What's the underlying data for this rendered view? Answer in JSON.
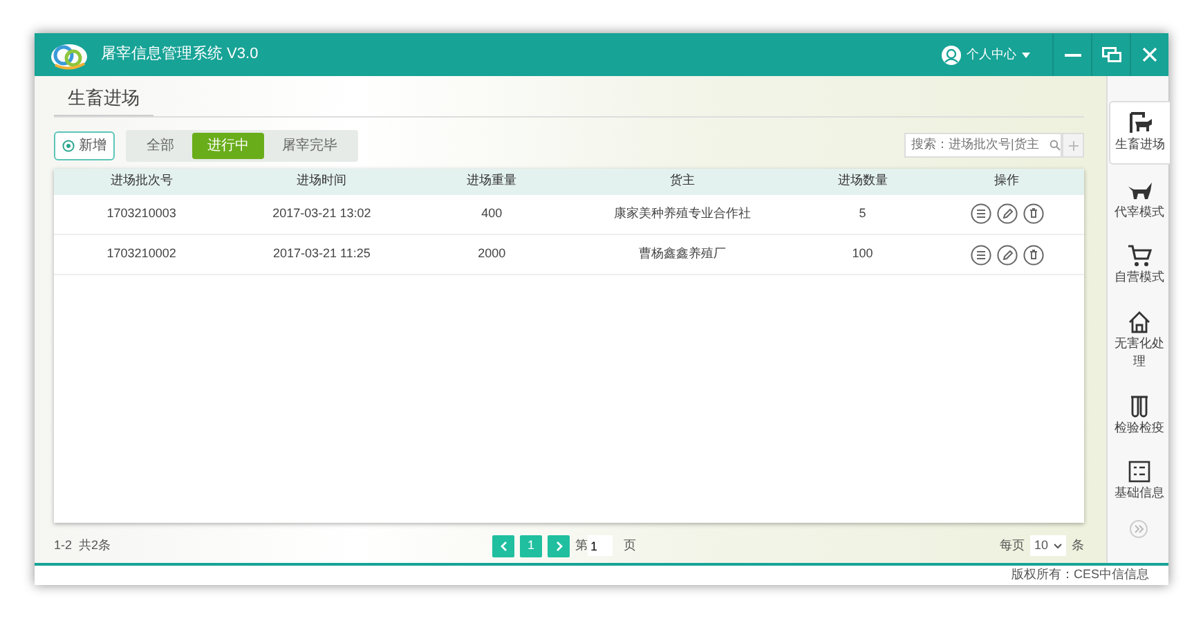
{
  "window": {
    "title": "屠宰信息管理系统 V3.0",
    "user_menu": "个人中心"
  },
  "page": {
    "title": "生畜进场"
  },
  "toolbar": {
    "add_button": "新增",
    "filters": [
      {
        "label": "全部",
        "selected": false
      },
      {
        "label": "进行中",
        "selected": true
      },
      {
        "label": "屠宰完毕",
        "selected": false
      }
    ],
    "search": {
      "placeholder": "搜索：进场批次号|货主"
    }
  },
  "table": {
    "columns": [
      "进场批次号",
      "进场时间",
      "进场重量",
      "货主",
      "进场数量",
      "操作"
    ],
    "rows": [
      {
        "cells": [
          "1703210003",
          "2017-03-21 13:02",
          "400",
          "康家美种养殖专业合作社",
          "5"
        ]
      },
      {
        "cells": [
          "1703210002",
          "2017-03-21 11:25",
          "2000",
          "曹杨鑫鑫养殖厂",
          "100"
        ]
      }
    ]
  },
  "pagination": {
    "summary": "1-2  共2条",
    "current_page": "1",
    "goto_prefix": "第",
    "goto_value": "1",
    "goto_suffix": "页",
    "per_page_prefix": "每页",
    "per_page": "10",
    "per_page_suffix": "条"
  },
  "sidebar": {
    "items": [
      {
        "label": "生畜进场",
        "kind": "livestock",
        "selected": true
      },
      {
        "label": "代宰模式",
        "kind": "cattle",
        "selected": false
      },
      {
        "label": "自营模式",
        "kind": "cart",
        "selected": false
      },
      {
        "label": "无害化处理",
        "kind": "house",
        "selected": false
      },
      {
        "label": "检验检疫",
        "kind": "tubes",
        "selected": false
      },
      {
        "label": "基础信息",
        "kind": "card",
        "selected": false
      }
    ]
  },
  "status_bar": {
    "copyright": "版权所有：CES中信信息"
  }
}
